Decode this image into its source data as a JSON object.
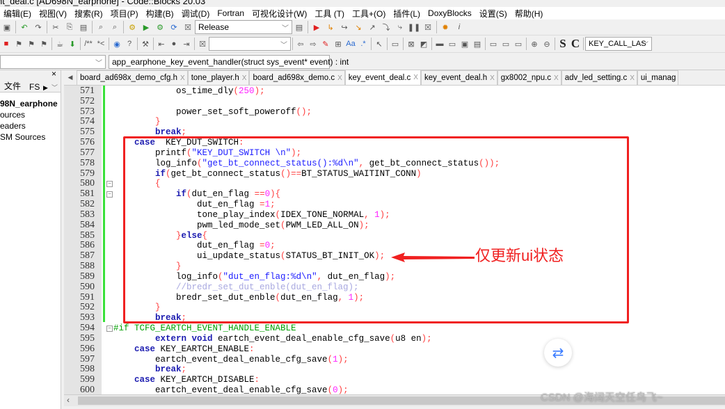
{
  "window": {
    "title": "nt_deal.c [AD698N_earphone] - Code::Blocks 20.03"
  },
  "menu": [
    "编辑(E)",
    "视图(V)",
    "搜索(R)",
    "项目(P)",
    "构建(B)",
    "调试(D)",
    "Fortran",
    "可视化设计(W)",
    "工具 (T)",
    "工具+(O)",
    "插件(L)",
    "DoxyBlocks",
    "设置(S)",
    "帮助(H)"
  ],
  "toolbar": {
    "build_target": "Release",
    "search_combo": "",
    "symbol_combo": "KEY_CALL_LAS",
    "comment_btn": "/**",
    "uncomment_btn": "*<",
    "s_btn": "S",
    "c_btn": "C",
    "function_combo": "app_earphone_key_event_handler(struct sys_event* event) : int"
  },
  "left_panel": {
    "tabs": [
      "文件",
      "FS"
    ],
    "items": [
      "98N_earphone",
      "ources",
      "eaders",
      "SM Sources"
    ]
  },
  "file_tabs": [
    {
      "label": "board_ad698x_demo_cfg.h",
      "active": false
    },
    {
      "label": "tone_player.h",
      "active": false
    },
    {
      "label": "board_ad698x_demo.c",
      "active": false
    },
    {
      "label": "key_event_deal.c",
      "active": true
    },
    {
      "label": "key_event_deal.h",
      "active": false
    },
    {
      "label": "gx8002_npu.c",
      "active": false
    },
    {
      "label": "adv_led_setting.c",
      "active": false
    },
    {
      "label": "ui_manag",
      "active": false
    }
  ],
  "code": [
    {
      "n": "571",
      "t": [
        [
          "t",
          "            os_time_dly"
        ],
        [
          "p",
          "("
        ],
        [
          "n",
          "250"
        ],
        [
          "p",
          ");"
        ]
      ]
    },
    {
      "n": "572",
      "t": []
    },
    {
      "n": "573",
      "t": [
        [
          "t",
          "            power_set_soft_poweroff"
        ],
        [
          "p",
          "();"
        ]
      ]
    },
    {
      "n": "574",
      "t": [
        [
          "p",
          "        }"
        ]
      ]
    },
    {
      "n": "575",
      "t": [
        [
          "k",
          "        break"
        ],
        [
          "p",
          ";"
        ]
      ]
    },
    {
      "n": "576",
      "t": [
        [
          "k",
          "    case"
        ],
        [
          "t",
          "  KEY_DUT_SWITCH"
        ],
        [
          "p",
          ":"
        ]
      ]
    },
    {
      "n": "577",
      "t": [
        [
          "t",
          "        printf"
        ],
        [
          "p",
          "("
        ],
        [
          "s",
          "\"KEY_DUT_SWITCH \\n\""
        ],
        [
          "p",
          ");"
        ]
      ]
    },
    {
      "n": "578",
      "t": [
        [
          "t",
          "        log_info"
        ],
        [
          "p",
          "("
        ],
        [
          "s",
          "\"get_bt_connect_status():%d\\n\""
        ],
        [
          "p",
          ","
        ],
        [
          "t",
          " get_bt_connect_status"
        ],
        [
          "p",
          "());"
        ]
      ]
    },
    {
      "n": "579",
      "t": [
        [
          "k",
          "        if"
        ],
        [
          "p",
          "("
        ],
        [
          "t",
          "get_bt_connect_status"
        ],
        [
          "p",
          "()=="
        ],
        [
          "t",
          "BT_STATUS_WAITINT_CONN"
        ],
        [
          "p",
          ")"
        ]
      ]
    },
    {
      "n": "580",
      "fold": true,
      "t": [
        [
          "p",
          "        {"
        ]
      ]
    },
    {
      "n": "581",
      "fold": true,
      "t": [
        [
          "k",
          "            if"
        ],
        [
          "p",
          "("
        ],
        [
          "t",
          "dut_en_flag "
        ],
        [
          "p",
          "=="
        ],
        [
          "n",
          "0"
        ],
        [
          "p",
          "){"
        ]
      ]
    },
    {
      "n": "582",
      "t": [
        [
          "t",
          "                dut_en_flag "
        ],
        [
          "p",
          "="
        ],
        [
          "n",
          "1"
        ],
        [
          "p",
          ";"
        ]
      ]
    },
    {
      "n": "583",
      "t": [
        [
          "t",
          "                tone_play_index"
        ],
        [
          "p",
          "("
        ],
        [
          "t",
          "IDEX_TONE_NORMAL"
        ],
        [
          "p",
          ","
        ],
        [
          "n",
          " 1"
        ],
        [
          "p",
          ");"
        ]
      ]
    },
    {
      "n": "584",
      "t": [
        [
          "t",
          "                pwm_led_mode_set"
        ],
        [
          "p",
          "("
        ],
        [
          "t",
          "PWM_LED_ALL_ON"
        ],
        [
          "p",
          ");"
        ]
      ]
    },
    {
      "n": "585",
      "t": [
        [
          "p",
          "            }"
        ],
        [
          "k",
          "else"
        ],
        [
          "p",
          "{"
        ]
      ]
    },
    {
      "n": "586",
      "t": [
        [
          "t",
          "                dut_en_flag "
        ],
        [
          "p",
          "="
        ],
        [
          "n",
          "0"
        ],
        [
          "p",
          ";"
        ]
      ]
    },
    {
      "n": "587",
      "t": [
        [
          "t",
          "                ui_update_status"
        ],
        [
          "p",
          "("
        ],
        [
          "t",
          "STATUS_BT_INIT_OK"
        ],
        [
          "p",
          ");"
        ]
      ]
    },
    {
      "n": "588",
      "t": [
        [
          "p",
          "            }"
        ]
      ]
    },
    {
      "n": "589",
      "t": [
        [
          "t",
          "            log_info"
        ],
        [
          "p",
          "("
        ],
        [
          "s",
          "\"dut_en_flag:%d\\n\""
        ],
        [
          "p",
          ","
        ],
        [
          "t",
          " dut_en_flag"
        ],
        [
          "p",
          ");"
        ]
      ]
    },
    {
      "n": "590",
      "t": [
        [
          "c",
          "            //bredr_set_dut_enble(dut_en_flag);"
        ]
      ]
    },
    {
      "n": "591",
      "t": [
        [
          "t",
          "            bredr_set_dut_enble"
        ],
        [
          "p",
          "("
        ],
        [
          "t",
          "dut_en_flag"
        ],
        [
          "p",
          ","
        ],
        [
          "n",
          " 1"
        ],
        [
          "p",
          ");"
        ]
      ]
    },
    {
      "n": "592",
      "t": [
        [
          "p",
          "        }"
        ]
      ]
    },
    {
      "n": "593",
      "t": [
        [
          "k",
          "        break"
        ],
        [
          "p",
          ";"
        ]
      ]
    },
    {
      "n": "594",
      "fold": true,
      "t": [
        [
          "pp",
          "#if TCFG_EARTCH_EVENT_HANDLE_ENABLE"
        ]
      ]
    },
    {
      "n": "595",
      "t": [
        [
          "k",
          "        extern void"
        ],
        [
          "t",
          " eartch_event_deal_enable_cfg_save"
        ],
        [
          "p",
          "("
        ],
        [
          "t",
          "u8 en"
        ],
        [
          "p",
          ");"
        ]
      ]
    },
    {
      "n": "596",
      "t": [
        [
          "k",
          "    case"
        ],
        [
          "t",
          " KEY_EARTCH_ENABLE"
        ],
        [
          "p",
          ":"
        ]
      ]
    },
    {
      "n": "597",
      "t": [
        [
          "t",
          "        eartch_event_deal_enable_cfg_save"
        ],
        [
          "p",
          "("
        ],
        [
          "n",
          "1"
        ],
        [
          "p",
          ");"
        ]
      ]
    },
    {
      "n": "598",
      "t": [
        [
          "k",
          "        break"
        ],
        [
          "p",
          ";"
        ]
      ]
    },
    {
      "n": "599",
      "t": [
        [
          "k",
          "    case"
        ],
        [
          "t",
          " KEY_EARTCH_DISABLE"
        ],
        [
          "p",
          ":"
        ]
      ]
    },
    {
      "n": "600",
      "t": [
        [
          "t",
          "        eartch_event_deal_enable_cfg_save"
        ],
        [
          "p",
          "("
        ],
        [
          "n",
          "0"
        ],
        [
          "p",
          ");"
        ]
      ]
    }
  ],
  "annotation": {
    "text": "仅更新ui状态",
    "color": "#f02020"
  },
  "watermark": "CSDN @海阔天空任鸟飞~",
  "colors": {
    "keyword": "#1c1cb0",
    "string": "#2020ff",
    "number": "#ff20ff",
    "operator": "#ff4040",
    "comment": "#a8a8e0",
    "preprocessor": "#00a000",
    "change_bar": "#3ae13a"
  }
}
